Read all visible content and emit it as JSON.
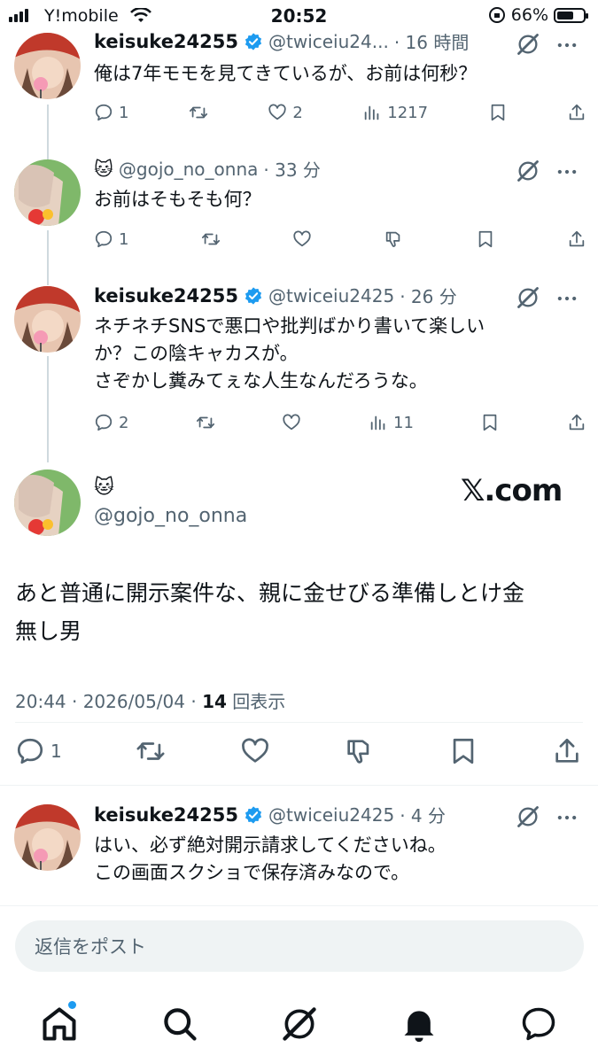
{
  "status_bar": {
    "carrier": "Y!mobile",
    "time": "20:52",
    "battery_text": "66%",
    "battery_level": 0.66
  },
  "tweets": [
    {
      "display_name": "keisuke24255",
      "handle": "@twiceiu24...",
      "time": "· 16 時間",
      "text": "俺は7年モモを見てきているが、お前は何秒？",
      "replies": "1",
      "likes": "2",
      "views": "1217"
    },
    {
      "display_name": "🐱",
      "handle": "@gojo_no_onna",
      "time": "· 33 分",
      "text": "お前はそもそも何？",
      "replies": "1"
    },
    {
      "display_name": "keisuke24255",
      "handle": "@twiceiu2425",
      "time": "· 26 分",
      "text": "ネチネチSNSで悪口や批判ばかり書いて楽しい\nか？この陰キャカスが。\nさぞかし糞みてぇな人生なんだろうな。",
      "replies": "2",
      "views": "11"
    }
  ],
  "focus": {
    "display_name": "🐱",
    "handle": "@gojo_no_onna",
    "watermark": "𝕏.com",
    "text": "あと普通に開示案件な、親に金せびる準備しとけ金\n無し男",
    "meta_prefix": "20:44 · 2026/05/04 · ",
    "views_count": "14",
    "views_label": " 回表示",
    "replies": "1"
  },
  "last_reply": {
    "display_name": "keisuke24255",
    "handle": "@twiceiu2425",
    "time": "· 4 分",
    "text": "はい、必ず絶対開示請求してくださいね。\nこの画面スクショで保存済みなので。"
  },
  "reply_box": {
    "placeholder": "返信をポスト"
  },
  "colors": {
    "accent": "#1d9bf0",
    "muted": "#536471",
    "text": "#0f1419",
    "border": "#eff3f4"
  },
  "icons": [
    "home-icon",
    "search-icon",
    "grok-icon",
    "bell-icon",
    "messages-icon",
    "reply-icon",
    "retweet-icon",
    "like-icon",
    "dislike-icon",
    "views-icon",
    "bookmark-icon",
    "share-icon"
  ]
}
